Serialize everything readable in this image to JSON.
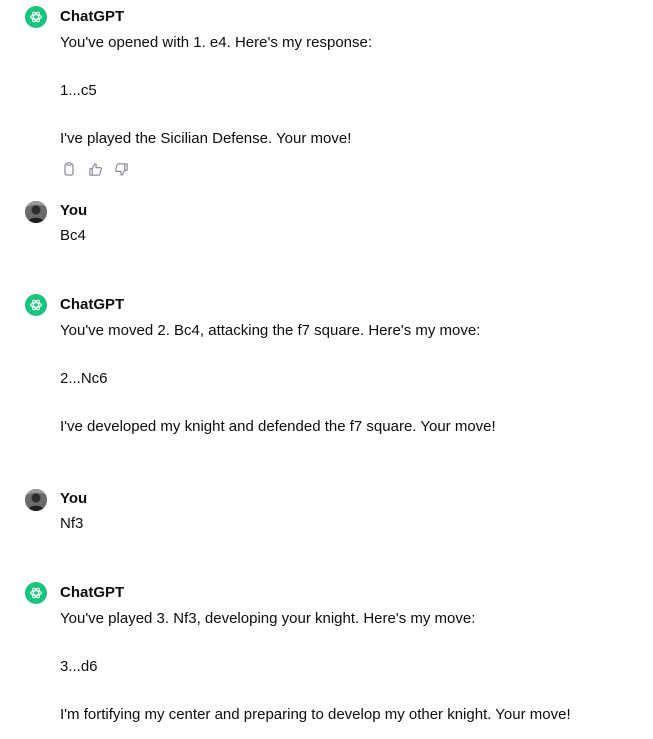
{
  "messages": [
    {
      "author": "ChatGPT",
      "role": "assistant",
      "lines": [
        "You've opened with 1. e4. Here's my response:",
        "1...c5",
        "I've played the Sicilian Defense. Your move!"
      ]
    },
    {
      "author": "You",
      "role": "user",
      "lines": [
        "Bc4"
      ]
    },
    {
      "author": "ChatGPT",
      "role": "assistant",
      "lines": [
        "You've moved 2. Bc4, attacking the f7 square. Here's my move:",
        "2...Nc6",
        "I've developed my knight and defended the f7 square. Your move!"
      ]
    },
    {
      "author": "You",
      "role": "user",
      "lines": [
        "Nf3"
      ]
    },
    {
      "author": "ChatGPT",
      "role": "assistant",
      "lines": [
        "You've played 3. Nf3, developing your knight. Here's my move:",
        "3...d6",
        "I'm fortifying my center and preparing to develop my other knight. Your move!"
      ]
    }
  ],
  "actions": [
    "copy-icon",
    "thumbs-up-icon",
    "thumbs-down-icon"
  ]
}
